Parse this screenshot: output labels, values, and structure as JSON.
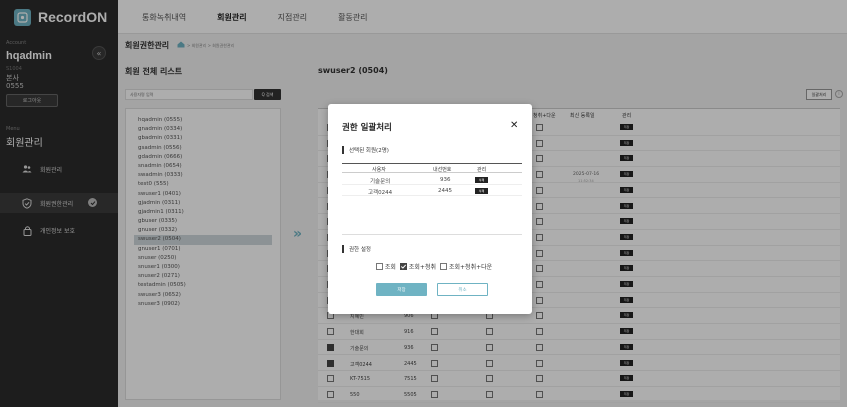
{
  "app": {
    "name": "RecordON"
  },
  "topnav": [
    "통화녹취내역",
    "회원관리",
    "지점관리",
    "활동관리"
  ],
  "sidebar": {
    "account_label": "Account",
    "account_name": "hqadmin",
    "account_sub1": "S1004",
    "account_sub2": "본사",
    "account_sub3": "0555",
    "logout": "로그아웃",
    "menu_label": "Menu",
    "menu_title": "회원관리",
    "items": [
      {
        "label": "회원관리",
        "icon": "users-icon"
      },
      {
        "label": "회원권한관리",
        "icon": "shield-icon"
      },
      {
        "label": "개인정보 보호",
        "icon": "lock-icon"
      }
    ]
  },
  "breadcrumb": {
    "title": "회원권한관리",
    "path": "> 회원관리 > 회원권한관리"
  },
  "list": {
    "title": "회원 전체 리스트",
    "search_placeholder": "사용자명 입력",
    "search_button": "Q 검색",
    "users": [
      "hqadmin (0555)",
      "gnadmin (0334)",
      "gbadmin (0331)",
      "gsadmin (0556)",
      "gdadmin (0666)",
      "snadmin (0654)",
      "swadmin (0333)",
      "test0 (555)",
      "swuser1 (0401)",
      "gjadmin (0311)",
      "gjadmin1 (0311)",
      "gbuser (0335)",
      "gnuser (0332)",
      "swuser2 (0504)",
      "gnuser1 (0701)",
      "snuser (0250)",
      "snuser1 (0300)",
      "snuser2 (0271)",
      "testadmin (0505)",
      "swuser3 (0652)",
      "snuser3 (0902)"
    ],
    "selected_index": 13
  },
  "detail": {
    "title": "swuser2 (0504)",
    "bulk_button": "일괄처리",
    "info_icon": "i",
    "headers": {
      "col_download": "청취+다운",
      "col_date": "최신 등록일",
      "col_manage": "관리"
    },
    "date_value": "2025-07-16",
    "date_sub": "11:52:34",
    "action_label": "저장",
    "rows": [
      {
        "name": "지혜민",
        "ext": "906",
        "checked": false
      },
      {
        "name": "한대희",
        "ext": "916",
        "checked": false
      },
      {
        "name": "기술문의",
        "ext": "936",
        "checked": true
      },
      {
        "name": "고객0244",
        "ext": "2445",
        "checked": true
      },
      {
        "name": "KT-7515",
        "ext": "7515",
        "checked": false
      },
      {
        "name": "550",
        "ext": "5505",
        "checked": false
      }
    ]
  },
  "modal": {
    "title": "권한 일괄처리",
    "close": "✕",
    "selected_label": "선택된 회원(2명)",
    "headers": [
      "사용자",
      "내선번호",
      "관리"
    ],
    "rows": [
      {
        "user": "기술문의",
        "ext": "936",
        "action": "삭제"
      },
      {
        "user": "고객0244",
        "ext": "2445",
        "action": "삭제"
      }
    ],
    "perm_label": "권한 설정",
    "perms": [
      {
        "label": "조회",
        "checked": false
      },
      {
        "label": "조회+청취",
        "checked": true
      },
      {
        "label": "조회+청취+다운",
        "checked": false
      }
    ],
    "apply": "저장",
    "cancel": "취소"
  }
}
